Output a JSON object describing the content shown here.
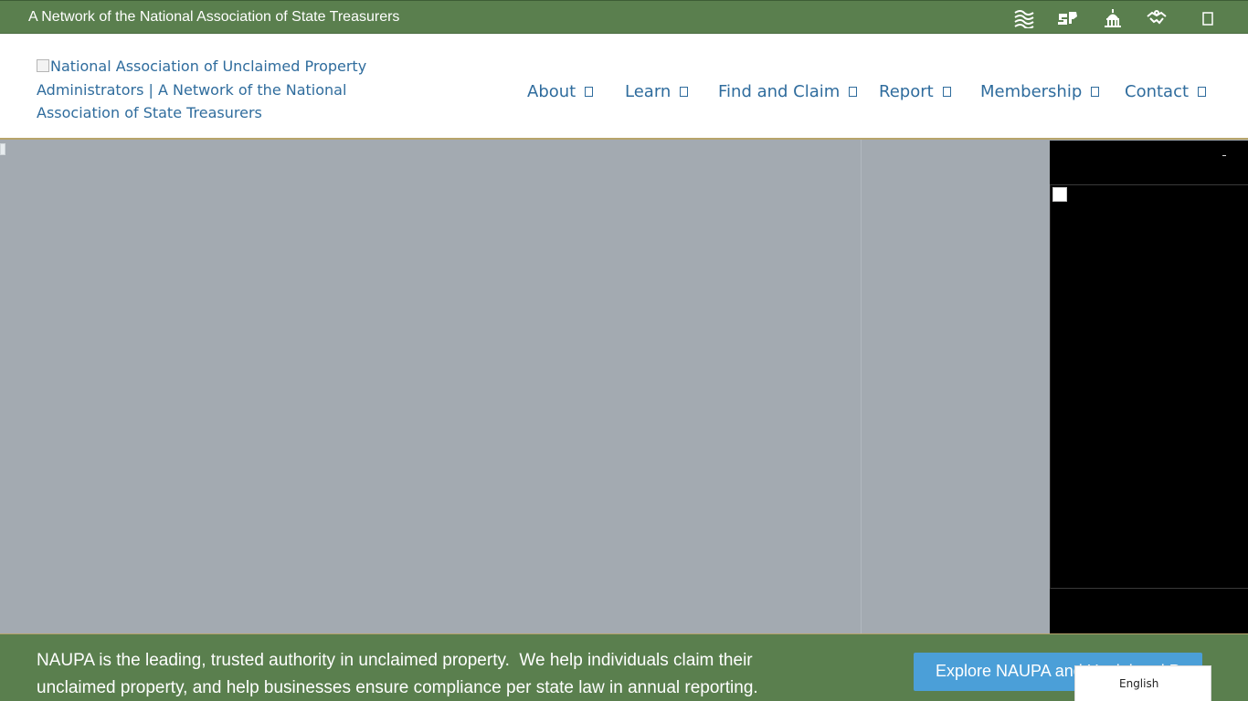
{
  "topbar": {
    "network_text": "A Network of the National Association of State Treasurers",
    "icons": [
      "waves-icon",
      "sp-logo-icon",
      "capitol-icon",
      "handshake-icon",
      "square-icon"
    ]
  },
  "header": {
    "logo_alt": "National Association of Unclaimed Property Administrators | A Network of the National Association of State Treasurers",
    "nav": [
      {
        "label": "About"
      },
      {
        "label": "Learn"
      },
      {
        "label": "Find and Claim"
      },
      {
        "label": "Report"
      },
      {
        "label": "Membership"
      },
      {
        "label": "Contact"
      }
    ]
  },
  "banner": {
    "text": "NAUPA is the leading, trusted authority in unclaimed property.  We help individuals claim their unclaimed property, and help businesses ensure compliance per state law in annual reporting.",
    "button_label": "Explore NAUPA and Unclaimed Property"
  },
  "language": {
    "selected": "English"
  },
  "colors": {
    "brand_green": "#5a7f4e",
    "link_blue": "#2f6c9d",
    "button_blue": "#4b9fd8",
    "accent_gold": "#b7a46b"
  }
}
